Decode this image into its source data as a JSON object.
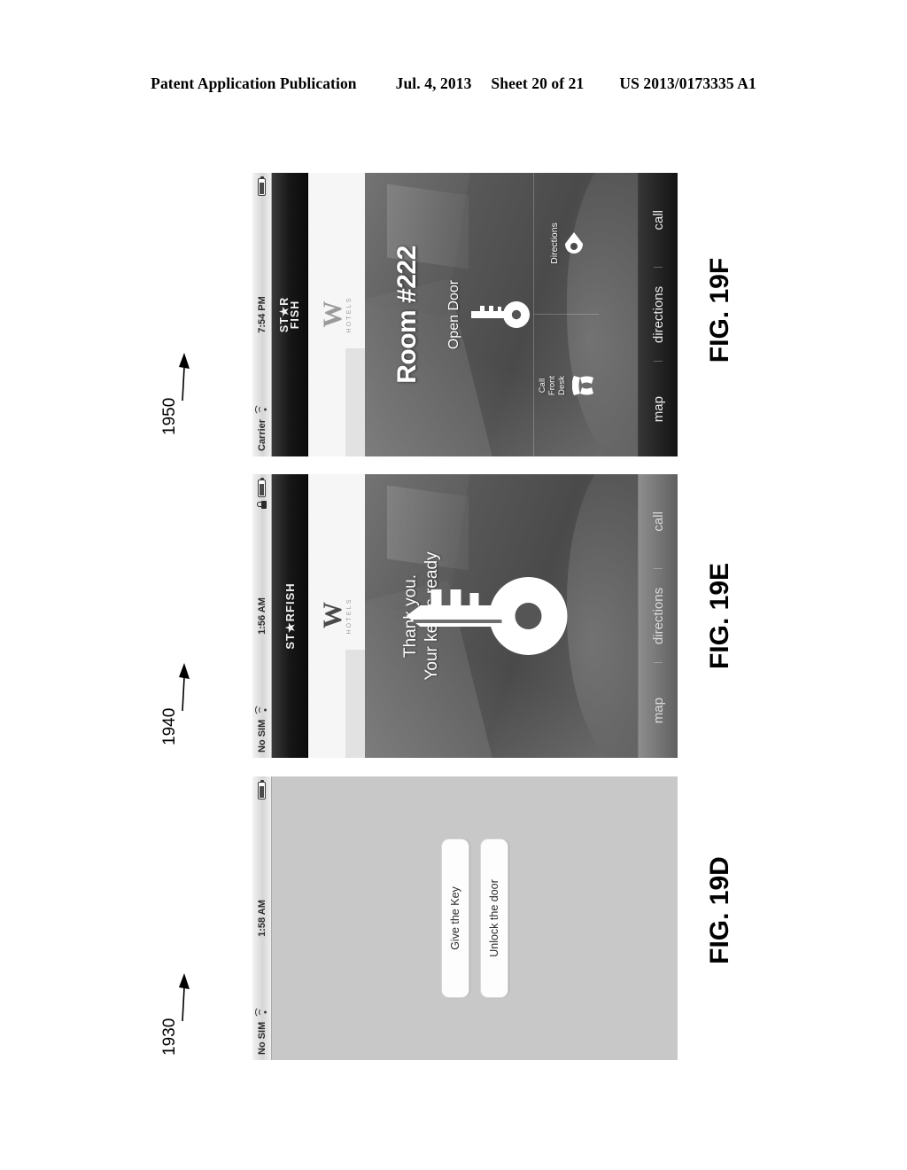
{
  "header": {
    "publication": "Patent Application Publication",
    "date": "Jul. 4, 2013",
    "sheet": "Sheet 20 of 21",
    "number": "US 2013/0173335 A1"
  },
  "figures": [
    {
      "id": "fig-19d",
      "label": "FIG. 19D",
      "reference": "1930",
      "status_bar": {
        "carrier": "No SIM",
        "wifi_icon": "wifi-icon",
        "time": "1:58 AM",
        "battery_icon": "battery-icon"
      },
      "buttons": [
        {
          "label": "Give the Key"
        },
        {
          "label": "Unlock the door"
        }
      ]
    },
    {
      "id": "fig-19e",
      "label": "FIG. 19E",
      "reference": "1940",
      "status_bar": {
        "carrier": "No SIM",
        "wifi_icon": "wifi-icon",
        "time": "1:56 AM",
        "download_icon": "download-icon",
        "lock_icon": "lock-icon",
        "battery_icon": "battery-icon"
      },
      "navbar": {
        "brand": "ST★RFISH"
      },
      "hotel_logo": {
        "mark": "W",
        "sub": "HOTELS"
      },
      "message": {
        "line1": "Thank you.",
        "line2": "Your key is ready"
      },
      "key_icon": "key-icon",
      "tabs": [
        {
          "label": "map",
          "icon": "map-icon"
        },
        {
          "label": "directions",
          "icon": "directions-icon"
        },
        {
          "label": "call",
          "icon": "call-icon"
        }
      ]
    },
    {
      "id": "fig-19f",
      "label": "FIG. 19F",
      "reference": "1950",
      "status_bar": {
        "carrier": "Carrier",
        "wifi_icon": "wifi-icon",
        "time": "7:54 PM",
        "battery_icon": "battery-icon"
      },
      "navbar": {
        "brand_line1": "ST★R",
        "brand_line2": "FISH"
      },
      "hotel_logo": {
        "mark": "W",
        "sub": "HOTELS"
      },
      "title": "Room #222",
      "actions": [
        {
          "label": "Open Door",
          "icon": "key-icon"
        },
        {
          "label": "Call\nFront\nDesk",
          "label_l1": "Call",
          "label_l2": "Front",
          "label_l3": "Desk",
          "icon": "phone-handset-icon"
        },
        {
          "label": "Directions",
          "icon": "location-pin-icon"
        }
      ],
      "tabs": [
        {
          "label": "map",
          "icon": "map-icon"
        },
        {
          "label": "directions",
          "icon": "directions-icon"
        },
        {
          "label": "call",
          "icon": "call-icon"
        }
      ]
    }
  ],
  "colors": {
    "page_background": "#ffffff",
    "ink": "#000000",
    "screen_gray": "#c8c8c8",
    "navbar_dark": "#151515",
    "photo_gray": "#585858"
  }
}
